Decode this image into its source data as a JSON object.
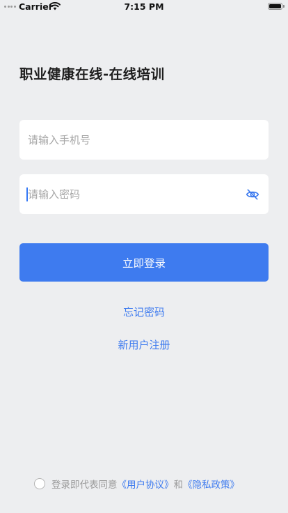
{
  "status_bar": {
    "carrier": "Carrier",
    "time": "7:15 PM"
  },
  "title": "职业健康在线-在线培训",
  "phone": {
    "placeholder": "请输入手机号",
    "value": ""
  },
  "password": {
    "placeholder": "请输入密码",
    "value": "",
    "toggle_icon": "eye-slash-icon"
  },
  "login_button": "立即登录",
  "forgot_password": "忘记密码",
  "register": "新用户注册",
  "agreement": {
    "prefix": "登录即代表同意",
    "user_agreement": "《用户协议》",
    "and": "和",
    "privacy_policy": "《隐私政策》",
    "checked": false
  },
  "colors": {
    "accent": "#3e7bef",
    "background": "#edeef0",
    "placeholder": "#a6a6a6"
  }
}
